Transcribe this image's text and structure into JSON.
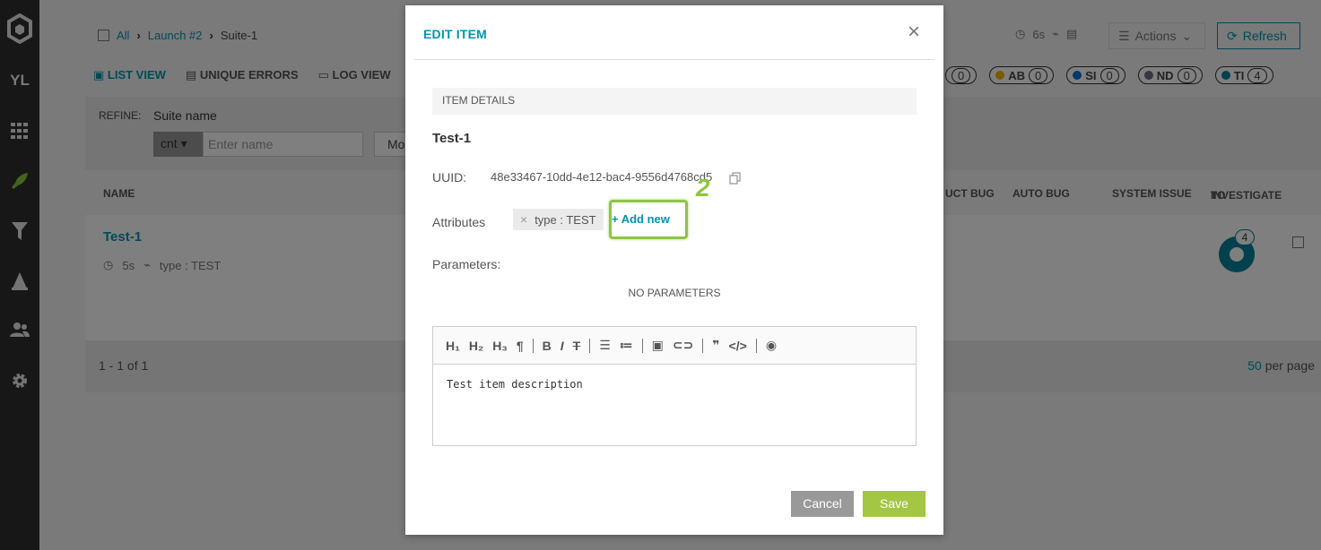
{
  "sidebar": {
    "avatar_initials": "YL",
    "items": [
      {
        "icon": "logo-icon"
      },
      {
        "icon": "grid-icon"
      },
      {
        "icon": "rocket-icon"
      },
      {
        "icon": "filter-icon"
      },
      {
        "icon": "tower-icon"
      },
      {
        "icon": "members-icon"
      },
      {
        "icon": "gear-icon"
      }
    ]
  },
  "breadcrumb": {
    "all": "All",
    "launch": "Launch #2",
    "suite": "Suite-1"
  },
  "header": {
    "duration": "6s",
    "actions_label": "Actions",
    "refresh_label": "Refresh"
  },
  "views": {
    "list_view": "LIST VIEW",
    "unique_errors": "UNIQUE ERRORS",
    "log_view": "LOG VIEW"
  },
  "defect_badges": [
    {
      "label": "",
      "count": "0",
      "color": "#ffffff"
    },
    {
      "label": "AB",
      "count": "0",
      "color": "#f2b601"
    },
    {
      "label": "SI",
      "count": "0",
      "color": "#0274d1"
    },
    {
      "label": "ND",
      "count": "0",
      "color": "#6f6f7e"
    },
    {
      "label": "TI",
      "count": "4",
      "color": "#00829b"
    }
  ],
  "refine": {
    "label": "REFINE:",
    "suite_name_label": "Suite name",
    "condition": "cnt",
    "name_placeholder": "Enter name",
    "more_label": "Mo"
  },
  "columns": {
    "name": "NAME",
    "product_bug": "UCT BUG",
    "auto_bug": "AUTO BUG",
    "system_issue": "SYSTEM ISSUE",
    "to_investigate_1": "TO",
    "to_investigate_2": "INVESTIGATE"
  },
  "row": {
    "name": "Test-1",
    "duration": "5s",
    "attribute": "type : TEST",
    "to_investigate_count": "4"
  },
  "pager": {
    "range": "1 - 1 of 1",
    "per_page_value": "50",
    "per_page_suffix": " per page"
  },
  "modal": {
    "title": "EDIT ITEM",
    "section_title": "ITEM DETAILS",
    "item_name": "Test-1",
    "uuid_label": "UUID:",
    "uuid_value": "48e33467-10dd-4e12-bac4-9556d4768cd5",
    "attributes_label": "Attributes",
    "attribute_chip": "type : TEST",
    "add_new_label": "+ Add new",
    "highlight_number": "2",
    "parameters_label": "Parameters:",
    "no_parameters": "NO PARAMETERS",
    "description": "Test item description",
    "cancel_label": "Cancel",
    "save_label": "Save",
    "toolbar": [
      "H1",
      "H2",
      "H3",
      "¶",
      "B",
      "I",
      "S",
      "ul",
      "ol",
      "image",
      "link",
      "quote",
      "code",
      "preview"
    ]
  },
  "colors": {
    "accent": "#0095b0",
    "save": "#a3c644",
    "highlight": "#8dc63f",
    "sidebar": "#2f2f2f"
  }
}
